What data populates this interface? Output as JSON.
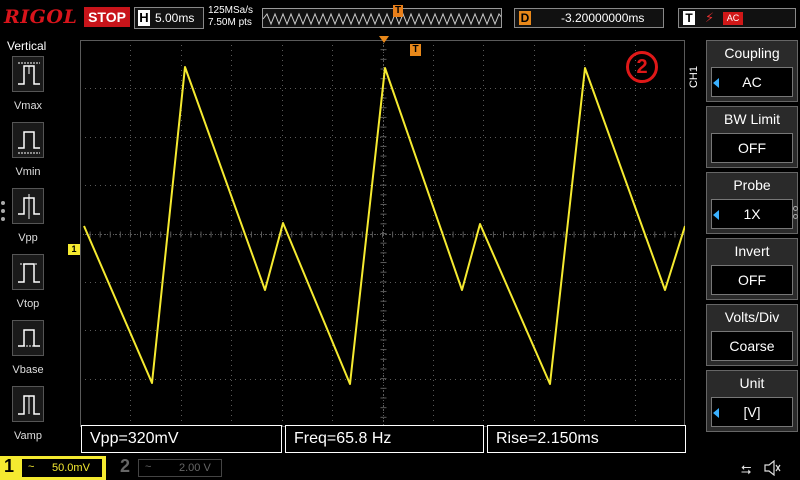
{
  "header": {
    "logo": "RIGOL",
    "run_state": "STOP",
    "timebase_key": "H",
    "timebase": "5.00ms",
    "sample_rate": "125MSa/s",
    "memory_depth": "7.50M pts",
    "delay_key": "D",
    "delay": "-3.20000000ms",
    "trigger_key": "T",
    "trigger_source": "AC"
  },
  "left_panel": {
    "title": "Vertical",
    "items": [
      {
        "label": "Vmax",
        "icon": "vmax-icon"
      },
      {
        "label": "Vmin",
        "icon": "vmin-icon"
      },
      {
        "label": "Vpp",
        "icon": "vpp-icon"
      },
      {
        "label": "Vtop",
        "icon": "vtop-icon"
      },
      {
        "label": "Vbase",
        "icon": "vbase-icon"
      },
      {
        "label": "Vamp",
        "icon": "vamp-icon"
      }
    ]
  },
  "screen": {
    "ch1_marker": "1",
    "trigger_marker": "T",
    "annotation": "2"
  },
  "measurements": {
    "vpp": "Vpp=320mV",
    "freq": "Freq=65.8 Hz",
    "rise": "Rise=2.150ms"
  },
  "right_menu": {
    "channel_tab": "CH1",
    "items": [
      {
        "title": "Coupling",
        "value": "AC",
        "selectable": true
      },
      {
        "title": "BW Limit",
        "value": "OFF",
        "selectable": false
      },
      {
        "title": "Probe",
        "value": "1X",
        "selectable": true
      },
      {
        "title": "Invert",
        "value": "OFF",
        "selectable": false
      },
      {
        "title": "Volts/Div",
        "value": "Coarse",
        "selectable": false
      },
      {
        "title": "Unit",
        "value": "[V]",
        "selectable": true
      }
    ]
  },
  "footer": {
    "ch1_num": "1",
    "ch1_coupling": "~",
    "ch1_scale": "50.0mV",
    "ch2_num": "2",
    "ch2_coupling": "~",
    "ch2_scale": "2.00 V"
  },
  "colors": {
    "trace": "#f5ea30",
    "grid": "#5a5a5a",
    "accent_red": "#d8141b",
    "trigger_orange": "#e8881a",
    "menu_arrow": "#3ab0ff"
  }
}
